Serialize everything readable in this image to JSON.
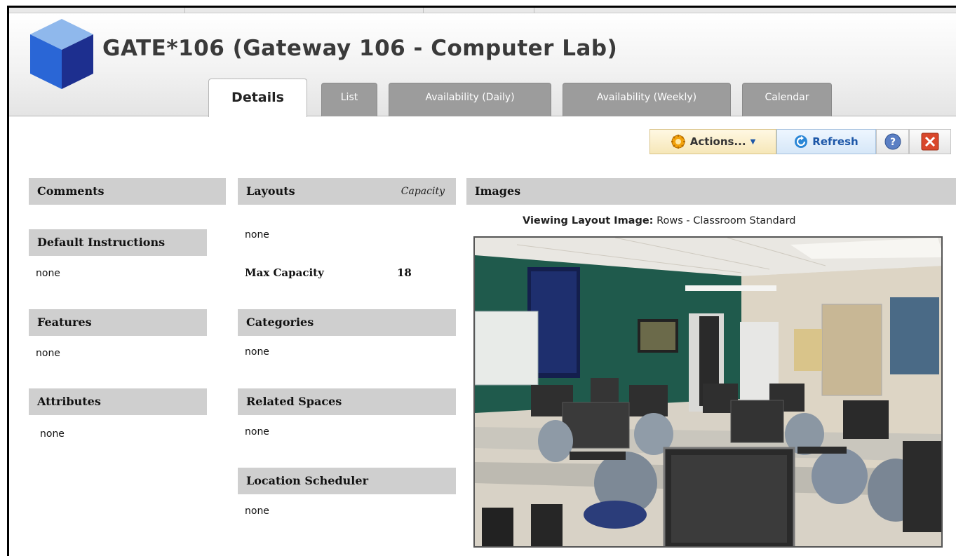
{
  "header": {
    "title": "GATE*106 (Gateway 106 - Computer Lab)"
  },
  "tabs": [
    {
      "label": "Details",
      "active": true
    },
    {
      "label": "List",
      "active": false
    },
    {
      "label": "Availability (Daily)",
      "active": false
    },
    {
      "label": "Availability (Weekly)",
      "active": false
    },
    {
      "label": "Calendar",
      "active": false
    }
  ],
  "toolbar": {
    "actions_label": "Actions...",
    "refresh_label": "Refresh",
    "help_icon": "help-icon",
    "close_icon": "close-icon"
  },
  "left": {
    "comments_title": "Comments",
    "default_instructions_title": "Default Instructions",
    "default_instructions_value": "none",
    "features_title": "Features",
    "features_value": "none",
    "attributes_title": "Attributes",
    "attributes_value": "none"
  },
  "middle": {
    "layouts_title": "Layouts",
    "capacity_col": "Capacity",
    "layouts_value": "none",
    "max_capacity_label": "Max Capacity",
    "max_capacity_value": "18",
    "categories_title": "Categories",
    "categories_value": "none",
    "related_spaces_title": "Related Spaces",
    "related_spaces_value": "none",
    "location_scheduler_title": "Location Scheduler",
    "location_scheduler_value": "none"
  },
  "images": {
    "title": "Images",
    "viewing_label": "Viewing Layout Image:",
    "viewing_value": "Rows - Classroom Standard"
  },
  "colors": {
    "header_gray": "#cfcfcf",
    "tab_inactive": "#9c9c9c",
    "cube_blue": "#2f54c8",
    "refresh_blue": "#1d57a8",
    "close_red": "#d9472b"
  }
}
